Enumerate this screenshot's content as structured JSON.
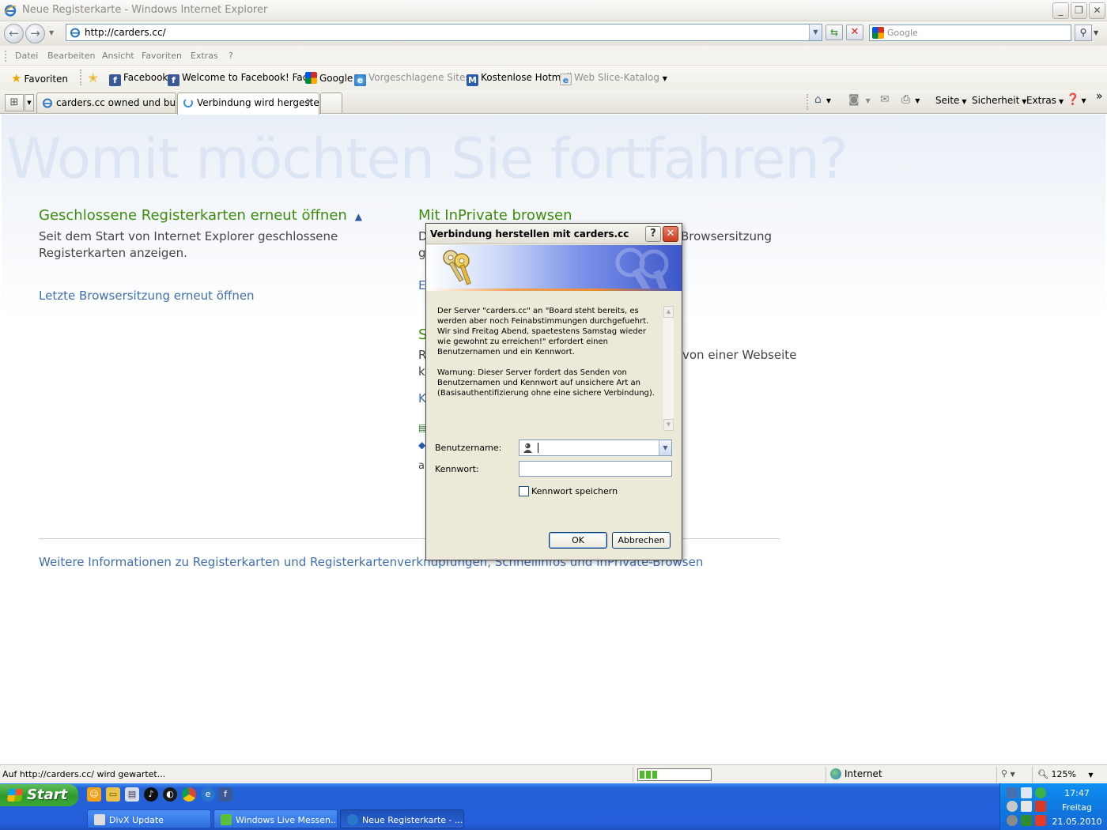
{
  "window": {
    "title": "Neue Registerkarte - Windows Internet Explorer",
    "minimize": "_",
    "maximize": "❐",
    "close": "✕"
  },
  "address_bar": {
    "url": "http://carders.cc/",
    "search_placeholder": "Google"
  },
  "menu": [
    "Datei",
    "Bearbeiten",
    "Ansicht",
    "Favoriten",
    "Extras",
    "?"
  ],
  "favorites_bar": {
    "favorites_label": "Favoriten",
    "items": [
      {
        "label": "Facebook",
        "icon": "facebook-icon"
      },
      {
        "label": "Welcome to Facebook! Fac...",
        "icon": "facebook-icon"
      },
      {
        "label": "Google",
        "icon": "google-icon"
      },
      {
        "label": "Vorgeschlagene Sites",
        "icon": "ie-icon"
      },
      {
        "label": "Kostenlose Hotmail",
        "icon": "msn-icon"
      },
      {
        "label": "Web Slice-Katalog",
        "icon": "webslice-icon"
      }
    ]
  },
  "tabs": [
    {
      "label": "carders.cc owned und buste..."
    },
    {
      "label": "Verbindung wird hergeste..."
    }
  ],
  "command_bar": {
    "page": "Seite",
    "security": "Sicherheit",
    "tools": "Extras",
    "more": "»"
  },
  "content": {
    "heading": "Womit möchten Sie fortfahren?",
    "reopen_tabs": {
      "title": "Geschlossene Registerkarten erneut öffnen",
      "text": "Seit dem Start von Internet Explorer geschlossene Registerkarten anzeigen."
    },
    "reopen_session_link": "Letzte Browsersitzung erneut öffnen",
    "inprivate": {
      "title": "Mit InPrivate browsen",
      "text_right": "Browsersitzung",
      "frag_d": "D",
      "frag_g": "g",
      "frag_e": "E"
    },
    "accelerators": {
      "frag_s": "S",
      "frag_r": "R",
      "frag_k": "k",
      "text_right": "von einer Webseite",
      "link_k": "K",
      "frag_a": "a"
    },
    "footer_link": "Weitere Informationen zu Registerkarten und Registerkartenverknüpfungen, Schnellinfos und InPrivate-Browsen"
  },
  "dialog": {
    "title": "Verbindung herstellen mit carders.cc",
    "help": "?",
    "close": "✕",
    "message_1": "Der Server \"carders.cc\" an \"Board steht bereits, es werden aber noch Feinabstimmungen durchgefuehrt. Wir sind Freitag Abend, spaetestens Samstag wieder wie gewohnt zu erreichen!\" erfordert einen Benutzernamen und ein Kennwort.",
    "message_2": "Warnung: Dieser Server fordert das Senden von Benutzernamen und Kennwort auf unsichere Art an (Basisauthentifizierung ohne eine sichere Verbindung).",
    "username_label": "Benutzername:",
    "password_label": "Kennwort:",
    "remember_label": "Kennwort speichern",
    "ok": "OK",
    "cancel": "Abbrechen"
  },
  "status_bar": {
    "text": "Auf http://carders.cc/ wird gewartet...",
    "progress": 0.25,
    "zone": "Internet",
    "zoom": "125%"
  },
  "taskbar": {
    "start": "Start",
    "tasks": [
      {
        "label": "DivX Update"
      },
      {
        "label": "Windows Live Messen..."
      },
      {
        "label": "Neue Registerkarte - ..."
      }
    ],
    "clock": {
      "time": "17:47",
      "day": "Freitag",
      "date": "21.05.2010"
    }
  }
}
